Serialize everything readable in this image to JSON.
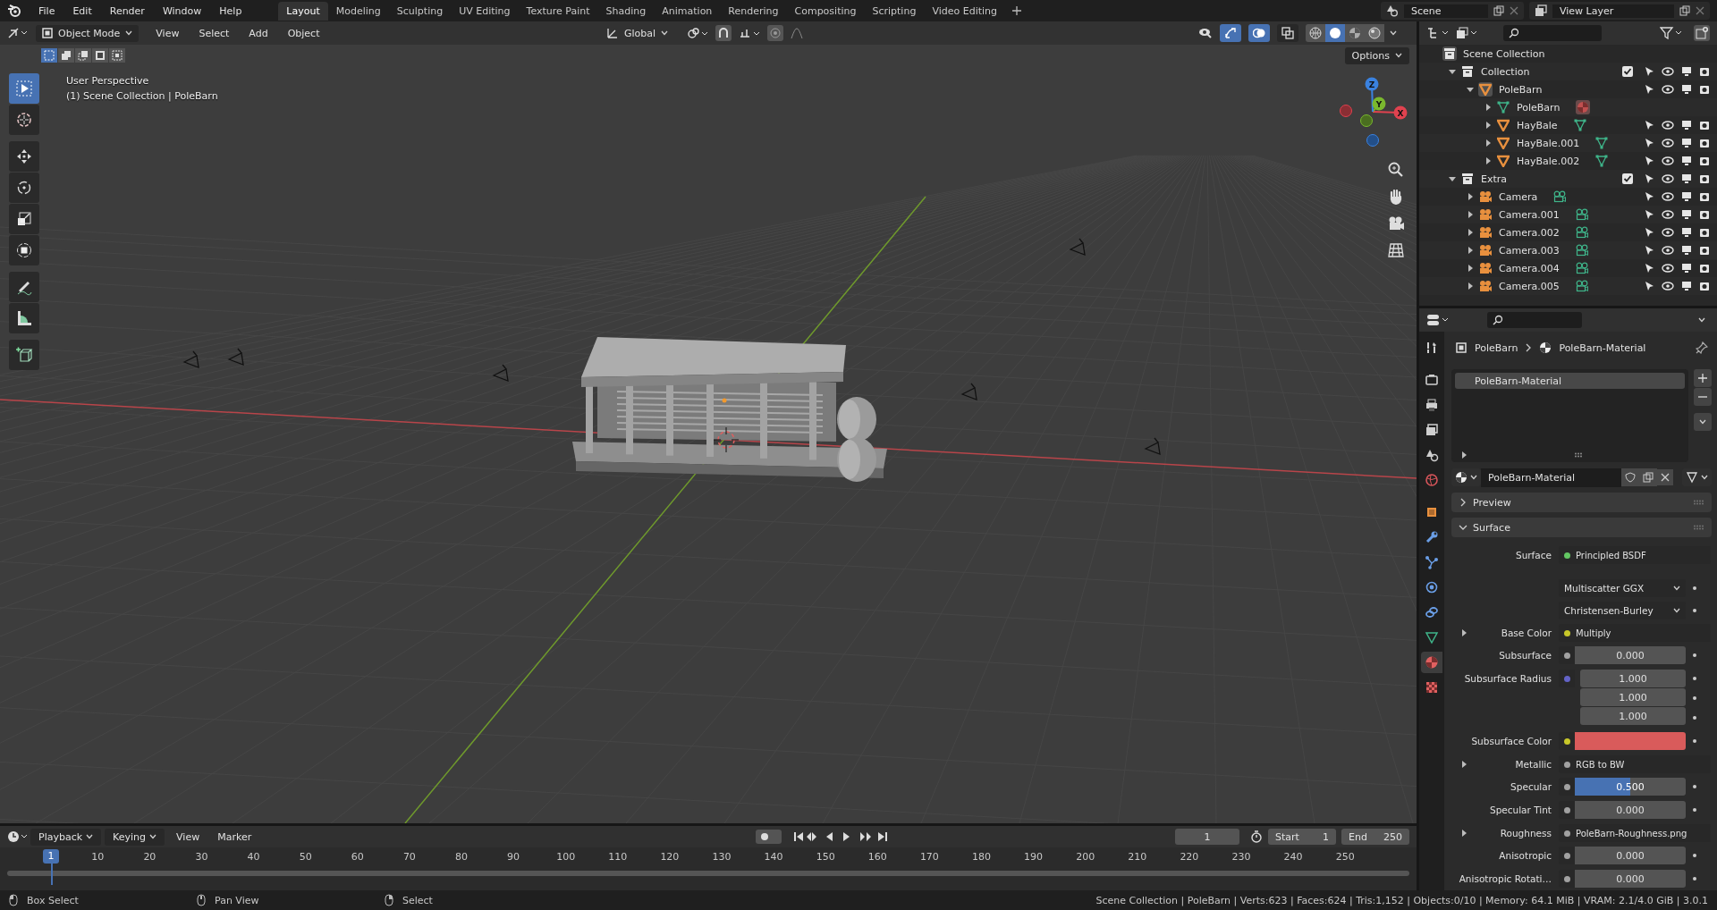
{
  "top_bar": {
    "menus": [
      "File",
      "Edit",
      "Render",
      "Window",
      "Help"
    ],
    "workspaces": [
      {
        "label": "Layout",
        "selected": true
      },
      {
        "label": "Modeling",
        "selected": false
      },
      {
        "label": "Sculpting",
        "selected": false
      },
      {
        "label": "UV Editing",
        "selected": false
      },
      {
        "label": "Texture Paint",
        "selected": false
      },
      {
        "label": "Shading",
        "selected": false
      },
      {
        "label": "Animation",
        "selected": false
      },
      {
        "label": "Rendering",
        "selected": false
      },
      {
        "label": "Compositing",
        "selected": false
      },
      {
        "label": "Scripting",
        "selected": false
      },
      {
        "label": "Video Editing",
        "selected": false
      }
    ],
    "scene": "Scene",
    "view_layer": "View Layer"
  },
  "viewport": {
    "mode": "Object Mode",
    "menus": [
      "View",
      "Select",
      "Add",
      "Object"
    ],
    "orientation": "Global",
    "options": "Options",
    "overlay_lines": [
      "User Perspective",
      "(1) Scene Collection | PoleBarn"
    ],
    "select_modes": [
      {
        "kind": "set",
        "selected": true
      },
      {
        "kind": "extend",
        "selected": false
      },
      {
        "kind": "subtract",
        "selected": false
      },
      {
        "kind": "invert",
        "selected": false
      },
      {
        "kind": "intersect",
        "selected": false
      }
    ],
    "gizmos_on": true,
    "overlays_on": true,
    "xray_on": false,
    "shading": [
      {
        "kind": "wireframe",
        "selected": false
      },
      {
        "kind": "solid",
        "selected": true
      },
      {
        "kind": "material",
        "selected": false
      },
      {
        "kind": "rendered",
        "selected": false
      }
    ],
    "tools": [
      {
        "kind": "select",
        "selected": true
      },
      {
        "kind": "cursor",
        "selected": false
      },
      {
        "kind": "move",
        "selected": false
      },
      {
        "kind": "rotate",
        "selected": false
      },
      {
        "kind": "scale",
        "selected": false
      },
      {
        "kind": "transform",
        "selected": false
      },
      {
        "kind": "annotate",
        "selected": false
      },
      {
        "kind": "measure",
        "selected": false
      },
      {
        "kind": "add_cube",
        "selected": false
      }
    ],
    "gizmo_axes": [
      "X",
      "Y",
      "Z"
    ]
  },
  "outliner": {
    "tree": [
      {
        "name": "Scene Collection",
        "kind": "scene_collection",
        "children": [
          {
            "name": "Collection",
            "kind": "collection",
            "expanded": true,
            "checked": true,
            "children": [
              {
                "name": "PoleBarn",
                "kind": "mesh_object",
                "expanded": true,
                "children": [
                  {
                    "name": "PoleBarn",
                    "kind": "mesh_data",
                    "expanded": false
                  },
                  {
                    "name": "HayBale",
                    "kind": "mesh_object",
                    "expanded": false
                  },
                  {
                    "name": "HayBale.001",
                    "kind": "mesh_object",
                    "expanded": false
                  },
                  {
                    "name": "HayBale.002",
                    "kind": "mesh_object",
                    "expanded": false
                  }
                ]
              }
            ]
          },
          {
            "name": "Extra",
            "kind": "collection",
            "expanded": true,
            "checked": true,
            "children": [
              {
                "name": "Camera",
                "kind": "camera",
                "expanded": false
              },
              {
                "name": "Camera.001",
                "kind": "camera",
                "expanded": false
              },
              {
                "name": "Camera.002",
                "kind": "camera",
                "expanded": false
              },
              {
                "name": "Camera.003",
                "kind": "camera",
                "expanded": false
              },
              {
                "name": "Camera.004",
                "kind": "camera",
                "expanded": false
              },
              {
                "name": "Camera.005",
                "kind": "camera",
                "expanded": false
              }
            ]
          }
        ]
      }
    ]
  },
  "properties": {
    "tabs": [
      {
        "kind": "tool",
        "selected": false
      },
      {
        "kind": "render",
        "selected": false
      },
      {
        "kind": "output",
        "selected": false
      },
      {
        "kind": "view_layer",
        "selected": false
      },
      {
        "kind": "scene",
        "selected": false
      },
      {
        "kind": "world",
        "selected": false
      },
      {
        "kind": "object",
        "selected": false
      },
      {
        "kind": "modifiers",
        "selected": false
      },
      {
        "kind": "particles",
        "selected": false
      },
      {
        "kind": "physics",
        "selected": false
      },
      {
        "kind": "constraints",
        "selected": false
      },
      {
        "kind": "data",
        "selected": false
      },
      {
        "kind": "material",
        "selected": true
      },
      {
        "kind": "texture",
        "selected": false
      }
    ],
    "breadcrumb": [
      "PoleBarn",
      "PoleBarn-Material"
    ],
    "material_slots": [
      {
        "name": "PoleBarn-Material",
        "selected": true
      }
    ],
    "material": "PoleBarn-Material",
    "panels": [
      {
        "title": "Preview",
        "expanded": false
      },
      {
        "title": "Surface",
        "expanded": true
      }
    ],
    "fields": [
      {
        "kind": "link",
        "label": "Surface",
        "value": "Principled BSDF",
        "color": "#63c763",
        "expandable": false
      },
      {
        "kind": "dropdown",
        "value": "Multiscatter GGX"
      },
      {
        "kind": "dropdown",
        "value": "Christensen-Burley"
      },
      {
        "kind": "link",
        "label": "Base Color",
        "value": "Multiply",
        "color": "#c7c729",
        "expandable": true
      },
      {
        "kind": "number",
        "label": "Subsurface",
        "value": "0.000",
        "color": "#a1a1a1"
      },
      {
        "kind": "vector",
        "label": "Subsurface Radius",
        "values": [
          "1.000",
          "1.000",
          "1.000"
        ],
        "color": "#6363c7"
      },
      {
        "kind": "swatch",
        "label": "Subsurface Color",
        "swatch": {
          "color": "#d95b5b"
        },
        "color": "#c7c729"
      },
      {
        "kind": "link",
        "label": "Metallic",
        "value": "RGB to BW",
        "color": "#a1a1a1",
        "expandable": true
      },
      {
        "kind": "slider",
        "label": "Specular",
        "value": "0.500",
        "level": 0.5,
        "color": "#a1a1a1"
      },
      {
        "kind": "number",
        "label": "Specular Tint",
        "value": "0.000",
        "color": "#a1a1a1"
      },
      {
        "kind": "link",
        "label": "Roughness",
        "value": "PoleBarn-Roughness.png",
        "color": "#a1a1a1",
        "expandable": true
      },
      {
        "kind": "number",
        "label": "Anisotropic",
        "value": "0.000",
        "color": "#a1a1a1"
      },
      {
        "kind": "number",
        "label": "Anisotropic Rotati…",
        "value": "0.000",
        "color": "#a1a1a1"
      }
    ]
  },
  "timeline": {
    "menus": [
      "Playback",
      "Keying",
      "View",
      "Marker"
    ],
    "current_frame": "1",
    "start_label": "Start",
    "start": "1",
    "end_label": "End",
    "end": "250",
    "playhead": "1",
    "ruler": [
      "10",
      "20",
      "30",
      "40",
      "50",
      "60",
      "70",
      "80",
      "90",
      "100",
      "110",
      "120",
      "130",
      "140",
      "150",
      "160",
      "170",
      "180",
      "190",
      "200",
      "210",
      "220",
      "230",
      "240",
      "250"
    ]
  },
  "status_bar": {
    "hints": [
      "Box Select",
      "Pan View",
      "Select"
    ],
    "stats": "Scene Collection | PoleBarn | Verts:623 | Faces:624 | Tris:1,152 | Objects:0/10 | Memory: 64.1 MiB | VRAM: 2.1/4.0 GiB | 3.0.1"
  }
}
